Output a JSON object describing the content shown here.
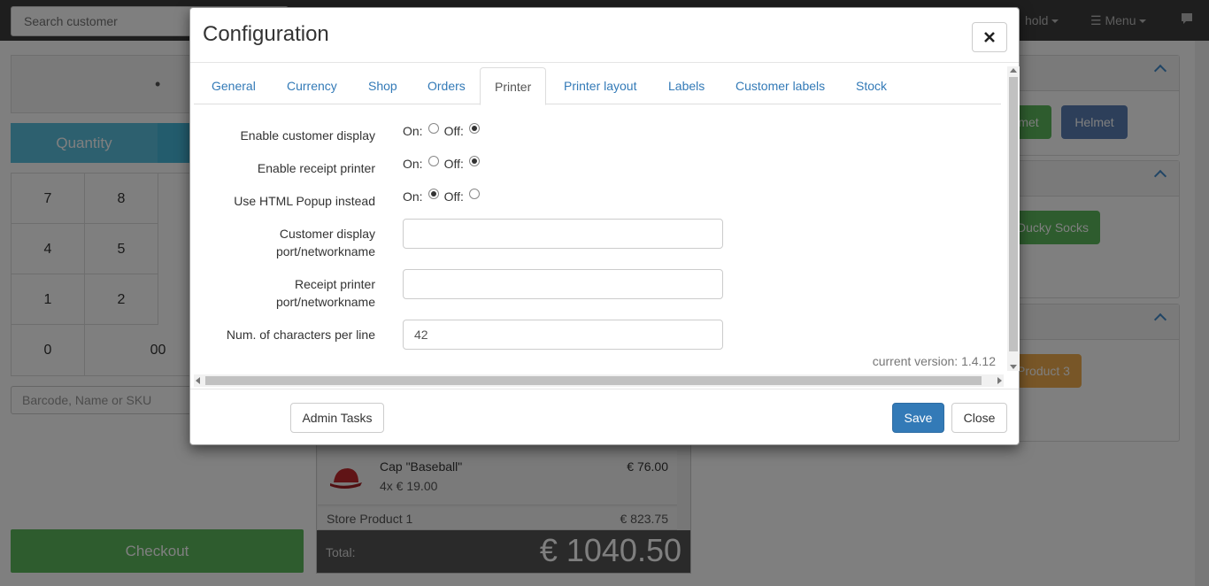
{
  "background": {
    "search_customer_placeholder": "Search customer",
    "nav_hold": "hold",
    "nav_menu": "Menu",
    "display_value": "•",
    "quantity_label": "Quantity",
    "keypad": [
      "7",
      "8",
      "4",
      "5",
      "1",
      "2",
      "0",
      "00"
    ],
    "barcode_placeholder": "Barcode, Name or SKU",
    "checkout_label": "Checkout",
    "order": {
      "items": [
        {
          "name": "Cap \"Baseball\"",
          "qty": "4x € 19.00",
          "price": "€ 76.00"
        }
      ],
      "store_product": {
        "name": "Store Product 1",
        "price": "€ 823.75"
      },
      "total_label": "Total:",
      "total_value": "€ 1040.50"
    },
    "products": {
      "row1": [
        "met",
        "Helmet"
      ],
      "row2": [
        "Ducky Socks"
      ],
      "row3": [
        "Product 3"
      ]
    },
    "colors": {
      "navbar": "#3c3c3c",
      "checkout": "#5cb85c",
      "quantity": "#5bc0de",
      "helmet": "#5a7fb5"
    }
  },
  "modal": {
    "title": "Configuration",
    "close_icon": "close-icon",
    "tabs": [
      {
        "label": "General"
      },
      {
        "label": "Currency"
      },
      {
        "label": "Shop"
      },
      {
        "label": "Orders"
      },
      {
        "label": "Printer",
        "active": true
      },
      {
        "label": "Printer layout"
      },
      {
        "label": "Labels"
      },
      {
        "label": "Customer labels"
      },
      {
        "label": "Stock"
      }
    ],
    "fields": {
      "customer_display": {
        "label": "Enable customer display",
        "on": "On:",
        "off": "Off:",
        "value": "off"
      },
      "receipt_printer": {
        "label": "Enable receipt printer",
        "on": "On:",
        "off": "Off:",
        "value": "off"
      },
      "html_popup": {
        "label": "Use HTML Popup instead",
        "on": "On:",
        "off": "Off:",
        "value": "on"
      },
      "customer_display_port": {
        "label_line1": "Customer display",
        "label_line2": "port/networkname",
        "value": ""
      },
      "receipt_printer_port": {
        "label_line1": "Receipt printer",
        "label_line2": "port/networkname",
        "value": ""
      },
      "chars_per_line": {
        "label": "Num. of characters per line",
        "value": "42"
      }
    },
    "version_text": "current version: 1.4.12",
    "footer": {
      "admin_tasks": "Admin Tasks",
      "save": "Save",
      "close": "Close"
    },
    "colors": {
      "primary": "#337ab7",
      "tab_link": "#337ab7"
    }
  }
}
